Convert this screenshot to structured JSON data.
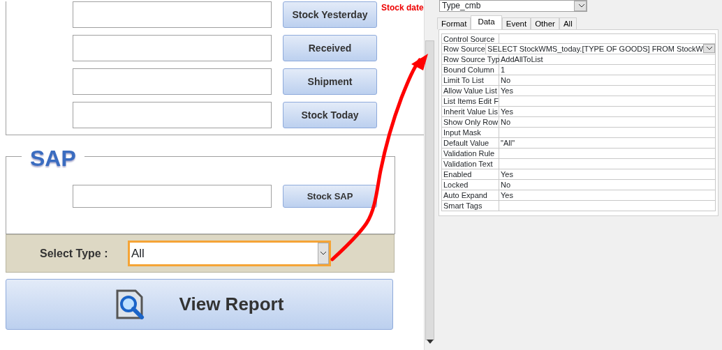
{
  "form": {
    "stock_date_label": "Stock date",
    "wms_rows": [
      {
        "button": "Stock Yesterday"
      },
      {
        "button": "Received"
      },
      {
        "button": "Shipment"
      },
      {
        "button": "Stock Today"
      }
    ],
    "sap": {
      "legend": "SAP",
      "rows": [
        {
          "button": "Stock SAP"
        }
      ]
    },
    "select_type": {
      "label": "Select Type :",
      "value": "All",
      "focused": true
    },
    "view_report_button": "View Report"
  },
  "property_sheet": {
    "object_combo": "Type_cmb",
    "tabs": [
      {
        "label": "Format",
        "selected": false
      },
      {
        "label": "Data",
        "selected": true
      },
      {
        "label": "Event",
        "selected": false
      },
      {
        "label": "Other",
        "selected": false
      },
      {
        "label": "All",
        "selected": false
      }
    ],
    "properties": [
      {
        "name": "Control Source",
        "has_dropdown": false
      },
      {
        "name": "Row Source",
        "value": "SELECT StockWMS_today.[TYPE OF GOODS] FROM StockW",
        "has_dropdown": true
      },
      {
        "name": "Row Source Typ",
        "value": "AddAllToList",
        "has_dropdown": false
      },
      {
        "name": "Bound Column",
        "value": "1",
        "has_dropdown": false
      },
      {
        "name": "Limit To List",
        "value": "No",
        "has_dropdown": false
      },
      {
        "name": "Allow Value List",
        "value": "Yes",
        "has_dropdown": false
      },
      {
        "name": "List Items Edit F",
        "has_dropdown": false
      },
      {
        "name": "Inherit Value Lis",
        "value": "Yes",
        "has_dropdown": false
      },
      {
        "name": "Show Only Row",
        "value": "No",
        "has_dropdown": false
      },
      {
        "name": "Input Mask",
        "has_dropdown": false
      },
      {
        "name": "Default Value",
        "value": "\"All\"",
        "has_dropdown": false
      },
      {
        "name": "Validation Rule",
        "has_dropdown": false
      },
      {
        "name": "Validation Text",
        "has_dropdown": false
      },
      {
        "name": "Enabled",
        "value": "Yes",
        "has_dropdown": false
      },
      {
        "name": "Locked",
        "value": "No",
        "has_dropdown": false
      },
      {
        "name": "Auto Expand",
        "value": "Yes",
        "has_dropdown": false
      },
      {
        "name": "Smart Tags",
        "has_dropdown": false
      }
    ]
  }
}
